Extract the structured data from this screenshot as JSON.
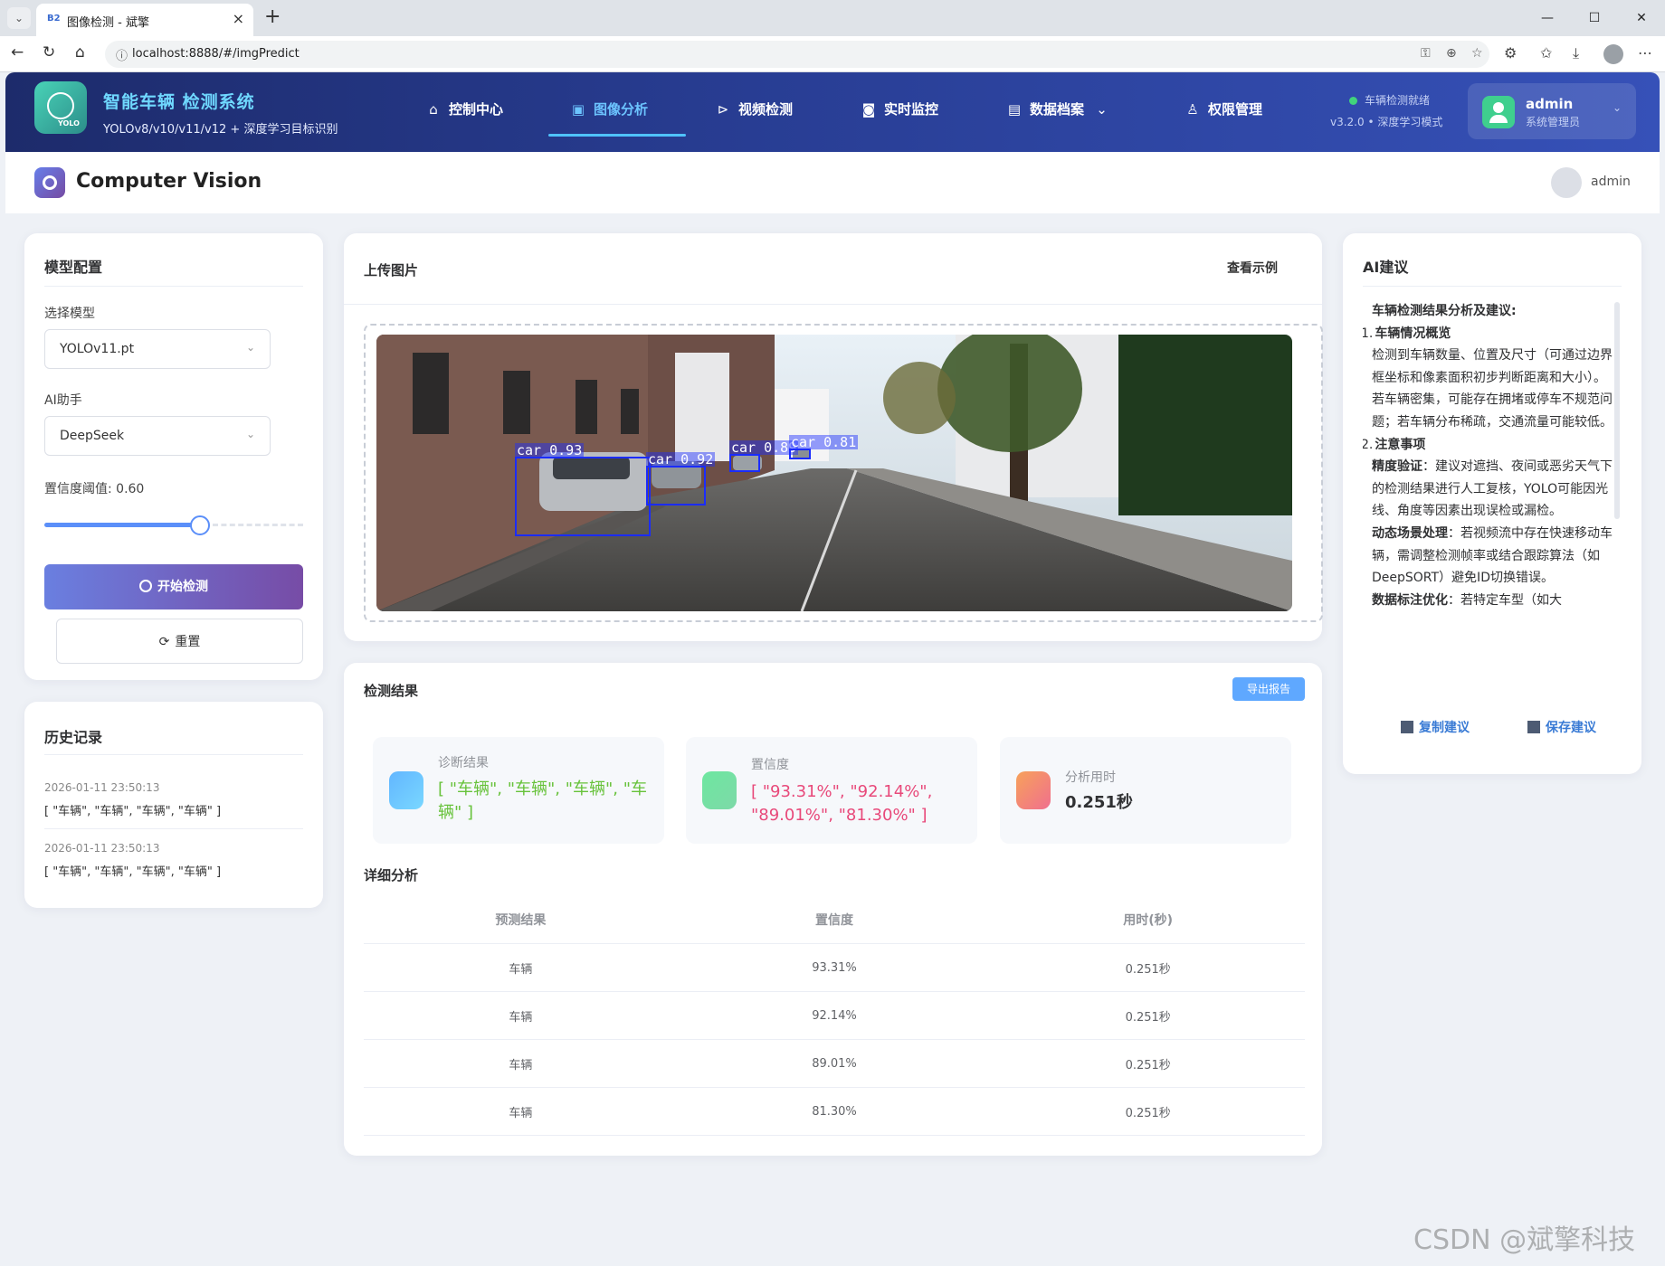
{
  "browser": {
    "tab_title": "图像检测 - 斌擎",
    "tab_favicon": "B2",
    "url": "localhost:8888/#/imgPredict"
  },
  "header": {
    "brand_title": "智能车辆 检测系统",
    "brand_subtitle": "YOLOv8/v10/v11/v12 + 深度学习目标识别",
    "logo_text": "YOLO",
    "nav": [
      {
        "label": "控制中心",
        "icon": "home-icon"
      },
      {
        "label": "图像分析",
        "icon": "image-icon",
        "active": true
      },
      {
        "label": "视频检测",
        "icon": "play-circle-icon"
      },
      {
        "label": "实时监控",
        "icon": "camera-icon"
      },
      {
        "label": "数据档案",
        "icon": "document-icon"
      },
      {
        "label": "权限管理",
        "icon": "user-icon"
      }
    ],
    "status_text": "车辆检测就绪",
    "version_text": "v3.2.0 • 深度学习模式",
    "user_name": "admin",
    "user_role": "系统管理员"
  },
  "subheader": {
    "title": "Computer Vision",
    "user": "admin"
  },
  "config": {
    "title": "模型配置",
    "model_label": "选择模型",
    "model_value": "YOLOv11.pt",
    "assistant_label": "AI助手",
    "assistant_value": "DeepSeek",
    "confidence_label": "置信度阈值: 0.60",
    "confidence_value": 0.6,
    "start_button": "开始检测",
    "reset_button": "重置"
  },
  "history": {
    "title": "历史记录",
    "items": [
      {
        "time": "2026-01-11 23:50:13",
        "value": "[ \"车辆\", \"车辆\", \"车辆\", \"车辆\" ]"
      },
      {
        "time": "2026-01-11 23:50:13",
        "value": "[ \"车辆\", \"车辆\", \"车辆\", \"车辆\" ]"
      }
    ]
  },
  "upload": {
    "title": "上传图片",
    "example_link": "查看示例",
    "detections": [
      {
        "label": "car 0.93"
      },
      {
        "label": "car 0.92"
      },
      {
        "label": "car 0.89"
      },
      {
        "label": "car 0.81"
      }
    ]
  },
  "results": {
    "title": "检测结果",
    "export_button": "导出报告",
    "diagnosis_label": "诊断结果",
    "diagnosis_value": "[ \"车辆\", \"车辆\", \"车辆\", \"车辆\" ]",
    "confidence_label": "置信度",
    "confidence_value": "[ \"93.31%\", \"92.14%\", \"89.01%\", \"81.30%\" ]",
    "time_label": "分析用时",
    "time_value": "0.251秒",
    "detail_title": "详细分析",
    "columns": [
      "预测结果",
      "置信度",
      "用时(秒)"
    ],
    "rows": [
      [
        "车辆",
        "93.31%",
        "0.251秒"
      ],
      [
        "车辆",
        "92.14%",
        "0.251秒"
      ],
      [
        "车辆",
        "89.01%",
        "0.251秒"
      ],
      [
        "车辆",
        "81.30%",
        "0.251秒"
      ]
    ]
  },
  "ai": {
    "title": "AI建议",
    "heading": "车辆检测结果分析及建议:",
    "s1_num": "1.",
    "s1_title": "车辆情况概览",
    "s1_p1": "检测到车辆数量、位置及尺寸（可通过边界框坐标和像素面积初步判断距离和大小）。",
    "s1_p2": "若车辆密集，可能存在拥堵或停车不规范问题；若车辆分布稀疏，交通流量可能较低。",
    "s2_num": "2.",
    "s2_title": "注意事项",
    "s2_p1_b": "精度验证",
    "s2_p1": "：建议对遮挡、夜间或恶劣天气下的检测结果进行人工复核，YOLO可能因光线、角度等因素出现误检或漏检。",
    "s2_p2_b": "动态场景处理",
    "s2_p2": "：若视频流中存在快速移动车辆，需调整检测帧率或结合跟踪算法（如DeepSORT）避免ID切换错误。",
    "s2_p3_b": "数据标注优化",
    "s2_p3": "：若特定车型（如大",
    "copy_button": "复制建议",
    "save_button": "保存建议"
  },
  "watermark": {
    "text": "斌擎科技",
    "csdn": "CSDN @斌擎科技"
  },
  "colors": {
    "accent": "#5b8ff9",
    "diagnosis_text": "#67c23a",
    "confidence_text": "#e8497a",
    "bbox": "#1b2cff"
  }
}
